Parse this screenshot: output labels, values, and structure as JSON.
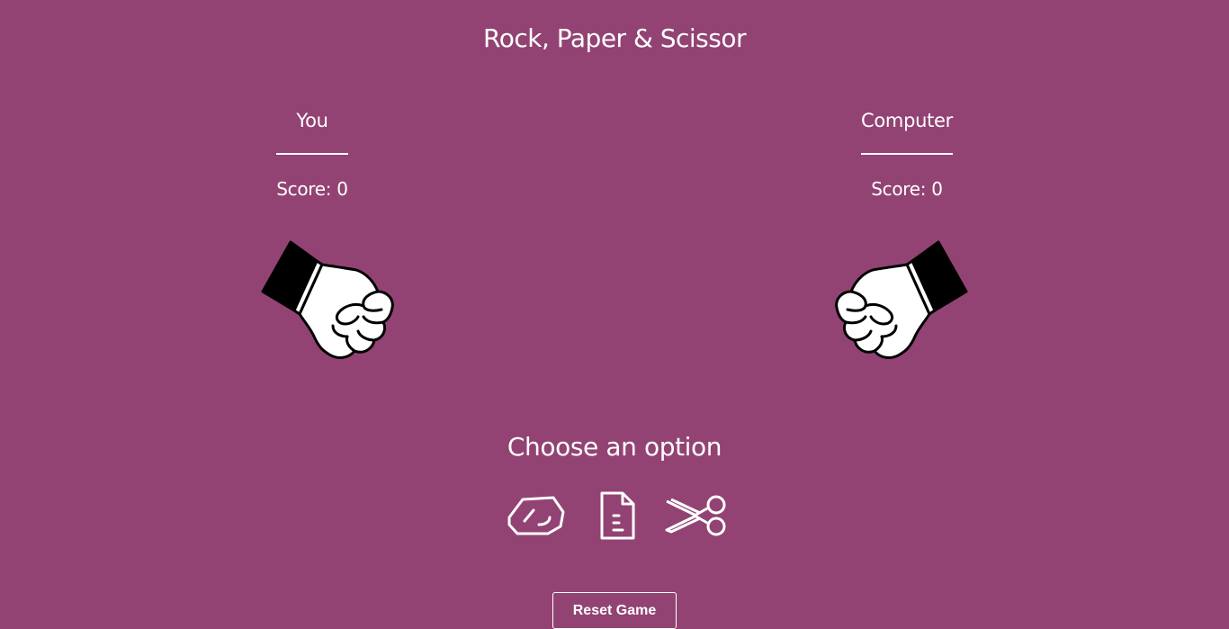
{
  "app": {
    "title": "Rock, Paper & Scissor",
    "background_color": "#924373",
    "text_color": "#ffffff"
  },
  "players": {
    "you": {
      "name": "You",
      "score_label": "Score: 0",
      "score": 0,
      "hand_icon": "fist-icon"
    },
    "computer": {
      "name": "Computer",
      "score_label": "Score: 0",
      "score": 0,
      "hand_icon": "fist-icon"
    }
  },
  "options": {
    "prompt": "Choose an option",
    "items": [
      {
        "id": "rock",
        "icon": "rock-icon"
      },
      {
        "id": "paper",
        "icon": "paper-icon"
      },
      {
        "id": "scissor",
        "icon": "scissors-icon"
      }
    ]
  },
  "actions": {
    "reset_label": "Reset Game"
  }
}
